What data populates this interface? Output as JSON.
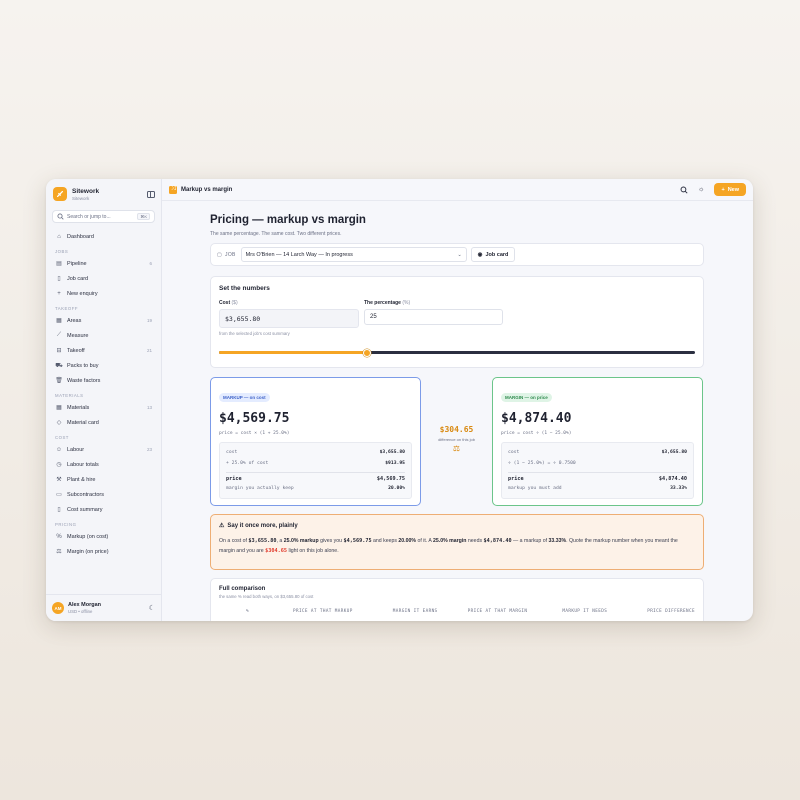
{
  "app": {
    "name": "Sitework",
    "workspace": "Sitework",
    "search_placeholder": "Search or jump to...",
    "search_shortcut": "⌘K"
  },
  "sidebar": {
    "dashboard": "Dashboard",
    "sections": {
      "jobs": "JOBS",
      "takeoff": "TAKEOFF",
      "materials": "MATERIALS",
      "cost": "COST",
      "pricing": "PRICING"
    },
    "jobs": [
      {
        "label": "Pipeline",
        "count": "6",
        "icon": "layers-icon"
      },
      {
        "label": "Job card",
        "count": "",
        "icon": "document-icon"
      },
      {
        "label": "New enquiry",
        "count": "",
        "icon": "plus-icon"
      }
    ],
    "takeoff": [
      {
        "label": "Areas",
        "count": "19",
        "icon": "grid-icon"
      },
      {
        "label": "Measure",
        "count": "",
        "icon": "ruler-icon"
      },
      {
        "label": "Takeoff",
        "count": "21",
        "icon": "cart-icon"
      },
      {
        "label": "Packs to buy",
        "count": "",
        "icon": "truck-icon"
      },
      {
        "label": "Waste factors",
        "count": "",
        "icon": "trash-icon"
      }
    ],
    "materials": [
      {
        "label": "Materials",
        "count": "13",
        "icon": "grid-icon"
      },
      {
        "label": "Material card",
        "count": "",
        "icon": "tag-icon"
      }
    ],
    "cost": [
      {
        "label": "Labour",
        "count": "23",
        "icon": "users-icon"
      },
      {
        "label": "Labour totals",
        "count": "",
        "icon": "clock-icon"
      },
      {
        "label": "Plant & hire",
        "count": "",
        "icon": "wrench-icon"
      },
      {
        "label": "Subcontractors",
        "count": "",
        "icon": "briefcase-icon"
      },
      {
        "label": "Cost summary",
        "count": "",
        "icon": "document-icon"
      }
    ],
    "pricing": [
      {
        "label": "Markup (on cost)",
        "count": "",
        "icon": "percent-icon"
      },
      {
        "label": "Margin (on price)",
        "count": "",
        "icon": "scale-icon"
      }
    ],
    "user": {
      "initials": "AM",
      "name": "Alex Morgan",
      "meta": "USD • offline"
    }
  },
  "topbar": {
    "title": "Markup vs margin",
    "new_label": "New"
  },
  "page": {
    "title": "Pricing — markup vs margin",
    "subtitle": "The same percentage. The same cost. Two different prices."
  },
  "job": {
    "label": "JOB",
    "selected": "Mrs O'Brien — 14 Larch Way — In progress",
    "card_button": "Job card"
  },
  "numbers": {
    "title": "Set the numbers",
    "cost_label": "Cost",
    "cost_unit": "($)",
    "cost_value": "$3,655.80",
    "cost_hint": "from the selected job's cost summary",
    "pct_label": "The percentage",
    "pct_unit": "(%)",
    "pct_value": "25",
    "slider_fraction": 0.31
  },
  "markup_card": {
    "pill": "MARKUP — on cost",
    "price": "$4,569.75",
    "formula": "price = cost × (1 + 25.0%)",
    "rows": [
      {
        "label": "cost",
        "value": "$3,655.80"
      },
      {
        "label": "+ 25.0% of cost",
        "value": "$913.95"
      }
    ],
    "total_label": "price",
    "total_value": "$4,569.75",
    "foot_label": "margin you actually keep",
    "foot_value": "20.00%"
  },
  "difference": {
    "value": "$304.65",
    "label": "difference on this job"
  },
  "margin_card": {
    "pill": "MARGIN — on price",
    "price": "$4,874.40",
    "formula": "price = cost ÷ (1 − 25.0%)",
    "rows": [
      {
        "label": "cost",
        "value": "$3,655.80"
      },
      {
        "label": "÷ (1 − 25.0%) = ÷ 0.7500",
        "value": ""
      }
    ],
    "total_label": "price",
    "total_value": "$4,874.40",
    "foot_label": "markup you must add",
    "foot_value": "33.33%"
  },
  "plain": {
    "title": "Say it once more, plainly",
    "t1": "On a cost of ",
    "cost": "$3,655.80",
    "t2": ", a ",
    "markup_pct": "25.0% markup",
    "t3": " gives you ",
    "markup_price": "$4,569.75",
    "t4": " and keeps ",
    "kept": "20.00%",
    "t5": " of it. A ",
    "margin_pct": "25.0% margin",
    "t6": " needs ",
    "margin_price": "$4,874.40",
    "t7": " — a markup of ",
    "markup_needed": "33.33%",
    "t8": ". Quote the markup number when you meant the margin and you are ",
    "diff": "$304.65",
    "t9": " light on this job alone."
  },
  "comparison": {
    "title": "Full comparison",
    "subtitle": "the same % read both ways, on $3,655.80 of cost",
    "headers": [
      "%",
      "PRICE AT THAT MARKUP",
      "MARGIN IT EARNS",
      "PRICE AT THAT MARGIN",
      "MARKUP IT NEEDS",
      "PRICE DIFFERENCE"
    ]
  },
  "colors": {
    "accent": "#f5a524",
    "markup_border": "#7c9be8",
    "margin_border": "#6cc58a",
    "warning_bg": "#fdf2e8",
    "danger": "#e0392b"
  }
}
